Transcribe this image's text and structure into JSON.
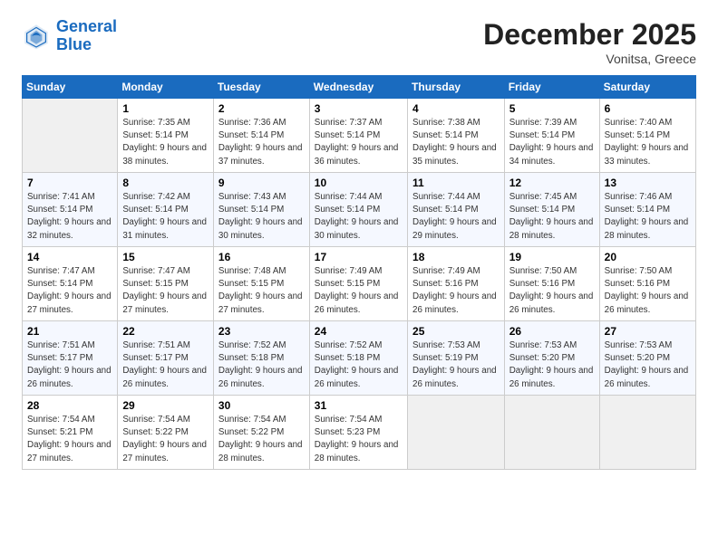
{
  "header": {
    "logo_line1": "General",
    "logo_line2": "Blue",
    "month_title": "December 2025",
    "subtitle": "Vonitsa, Greece"
  },
  "weekdays": [
    "Sunday",
    "Monday",
    "Tuesday",
    "Wednesday",
    "Thursday",
    "Friday",
    "Saturday"
  ],
  "weeks": [
    [
      {
        "day": "",
        "empty": true
      },
      {
        "day": "1",
        "sunrise": "7:35 AM",
        "sunset": "5:14 PM",
        "daylight": "9 hours and 38 minutes."
      },
      {
        "day": "2",
        "sunrise": "7:36 AM",
        "sunset": "5:14 PM",
        "daylight": "9 hours and 37 minutes."
      },
      {
        "day": "3",
        "sunrise": "7:37 AM",
        "sunset": "5:14 PM",
        "daylight": "9 hours and 36 minutes."
      },
      {
        "day": "4",
        "sunrise": "7:38 AM",
        "sunset": "5:14 PM",
        "daylight": "9 hours and 35 minutes."
      },
      {
        "day": "5",
        "sunrise": "7:39 AM",
        "sunset": "5:14 PM",
        "daylight": "9 hours and 34 minutes."
      },
      {
        "day": "6",
        "sunrise": "7:40 AM",
        "sunset": "5:14 PM",
        "daylight": "9 hours and 33 minutes."
      }
    ],
    [
      {
        "day": "7",
        "sunrise": "7:41 AM",
        "sunset": "5:14 PM",
        "daylight": "9 hours and 32 minutes."
      },
      {
        "day": "8",
        "sunrise": "7:42 AM",
        "sunset": "5:14 PM",
        "daylight": "9 hours and 31 minutes."
      },
      {
        "day": "9",
        "sunrise": "7:43 AM",
        "sunset": "5:14 PM",
        "daylight": "9 hours and 30 minutes."
      },
      {
        "day": "10",
        "sunrise": "7:44 AM",
        "sunset": "5:14 PM",
        "daylight": "9 hours and 30 minutes."
      },
      {
        "day": "11",
        "sunrise": "7:44 AM",
        "sunset": "5:14 PM",
        "daylight": "9 hours and 29 minutes."
      },
      {
        "day": "12",
        "sunrise": "7:45 AM",
        "sunset": "5:14 PM",
        "daylight": "9 hours and 28 minutes."
      },
      {
        "day": "13",
        "sunrise": "7:46 AM",
        "sunset": "5:14 PM",
        "daylight": "9 hours and 28 minutes."
      }
    ],
    [
      {
        "day": "14",
        "sunrise": "7:47 AM",
        "sunset": "5:14 PM",
        "daylight": "9 hours and 27 minutes."
      },
      {
        "day": "15",
        "sunrise": "7:47 AM",
        "sunset": "5:15 PM",
        "daylight": "9 hours and 27 minutes."
      },
      {
        "day": "16",
        "sunrise": "7:48 AM",
        "sunset": "5:15 PM",
        "daylight": "9 hours and 27 minutes."
      },
      {
        "day": "17",
        "sunrise": "7:49 AM",
        "sunset": "5:15 PM",
        "daylight": "9 hours and 26 minutes."
      },
      {
        "day": "18",
        "sunrise": "7:49 AM",
        "sunset": "5:16 PM",
        "daylight": "9 hours and 26 minutes."
      },
      {
        "day": "19",
        "sunrise": "7:50 AM",
        "sunset": "5:16 PM",
        "daylight": "9 hours and 26 minutes."
      },
      {
        "day": "20",
        "sunrise": "7:50 AM",
        "sunset": "5:16 PM",
        "daylight": "9 hours and 26 minutes."
      }
    ],
    [
      {
        "day": "21",
        "sunrise": "7:51 AM",
        "sunset": "5:17 PM",
        "daylight": "9 hours and 26 minutes."
      },
      {
        "day": "22",
        "sunrise": "7:51 AM",
        "sunset": "5:17 PM",
        "daylight": "9 hours and 26 minutes."
      },
      {
        "day": "23",
        "sunrise": "7:52 AM",
        "sunset": "5:18 PM",
        "daylight": "9 hours and 26 minutes."
      },
      {
        "day": "24",
        "sunrise": "7:52 AM",
        "sunset": "5:18 PM",
        "daylight": "9 hours and 26 minutes."
      },
      {
        "day": "25",
        "sunrise": "7:53 AM",
        "sunset": "5:19 PM",
        "daylight": "9 hours and 26 minutes."
      },
      {
        "day": "26",
        "sunrise": "7:53 AM",
        "sunset": "5:20 PM",
        "daylight": "9 hours and 26 minutes."
      },
      {
        "day": "27",
        "sunrise": "7:53 AM",
        "sunset": "5:20 PM",
        "daylight": "9 hours and 26 minutes."
      }
    ],
    [
      {
        "day": "28",
        "sunrise": "7:54 AM",
        "sunset": "5:21 PM",
        "daylight": "9 hours and 27 minutes."
      },
      {
        "day": "29",
        "sunrise": "7:54 AM",
        "sunset": "5:22 PM",
        "daylight": "9 hours and 27 minutes."
      },
      {
        "day": "30",
        "sunrise": "7:54 AM",
        "sunset": "5:22 PM",
        "daylight": "9 hours and 28 minutes."
      },
      {
        "day": "31",
        "sunrise": "7:54 AM",
        "sunset": "5:23 PM",
        "daylight": "9 hours and 28 minutes."
      },
      {
        "day": "",
        "empty": true
      },
      {
        "day": "",
        "empty": true
      },
      {
        "day": "",
        "empty": true
      }
    ]
  ]
}
